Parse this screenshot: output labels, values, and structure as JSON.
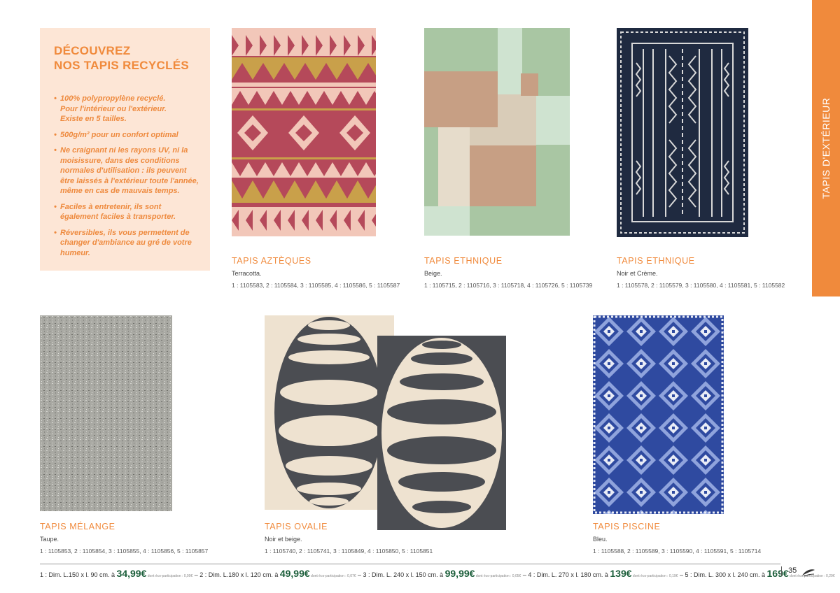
{
  "promo": {
    "title_line1": "DÉCOUVREZ",
    "title_line2": "NOS TAPIS RECYCLÉS",
    "bullets": [
      "100% polypropylène recyclé. Pour l'intérieur ou l'extérieur. Existe en 5 tailles.",
      "500g/m² pour un confort optimal",
      "Ne craignant ni les rayons UV, ni la moisissure, dans des conditions normales d'utilisation : ils peuvent être laissés à l'extérieur toute l'année, même en cas de mauvais temps.",
      "Faciles à entretenir, ils sont également faciles à transporter.",
      "Réversibles, ils vous permettent de changer d'ambiance au gré de votre humeur."
    ]
  },
  "side_tab": "TAPIS D'EXTÉRIEUR",
  "products": [
    {
      "title": "TAPIS AZTÈQUES",
      "color": "Terracotta.",
      "refs": "1 : 1105583, 2 : 1105584, 3 : 1105585, 4 : 1105586, 5 : 1105587",
      "image_icon": "aztec-rug-image"
    },
    {
      "title": "TAPIS ETHNIQUE",
      "color": "Beige.",
      "refs": "1 : 1105715, 2 : 1105716, 3 : 1105718, 4 : 1105726, 5 : 1105739",
      "image_icon": "patchwork-rug-image"
    },
    {
      "title": "TAPIS ETHNIQUE",
      "color": "Noir et Crème.",
      "refs": "1 : 1105578, 2 : 1105579, 3 : 1105580, 4 : 1105581, 5 : 1105582",
      "image_icon": "black-ethnic-rug-image"
    },
    {
      "title": "TAPIS MÉLANGE",
      "color": "Taupe.",
      "refs": "1 : 1105853, 2 : 1105854, 3 : 1105855, 4 : 1105856, 5 : 1105857",
      "image_icon": "melange-rug-image"
    },
    {
      "title": "TAPIS OVALIE",
      "color": "Noir et beige.",
      "refs": "1 : 1105740, 2 : 1105741, 3 : 1105849, 4 : 1105850, 5 : 1105851",
      "image_icon": "oval-rug-image"
    },
    {
      "title": "TAPIS PISCINE",
      "color": "Bleu.",
      "refs": "1 : 1105588, 2 : 1105589, 3 : 1105590, 4 : 1105591, 5 : 1105714",
      "image_icon": "blue-diamond-rug-image"
    }
  ],
  "footer": {
    "items": [
      {
        "dims": "1 : Dim. L.150 x l. 90 cm. à ",
        "price": "34,99€",
        "eco": " dont éco-participation : 0,09€"
      },
      {
        "dims": " – 2 : Dim. L.180 x l. 120 cm. à ",
        "price": "49,99€",
        "eco": " dont éco-participation : 0,07€"
      },
      {
        "dims": " – 3 : Dim. L. 240 x l. 150 cm. à ",
        "price": "99,99€",
        "eco": " dont éco-participation : 0,05€"
      },
      {
        "dims": " – 4 : Dim. L. 270 x l. 180 cm. à ",
        "price": "139€",
        "eco": " dont éco-participation : 0,19€"
      },
      {
        "dims": " – 5 : Dim. L. 300 x l. 240 cm. à ",
        "price": "169€",
        "eco": " dont éco-participation : 0,29€"
      }
    ],
    "page_number": "35"
  },
  "colors": {
    "accent_orange": "#f08a3c",
    "promo_bg": "#fde6d6",
    "price_green": "#1b5e3a"
  }
}
